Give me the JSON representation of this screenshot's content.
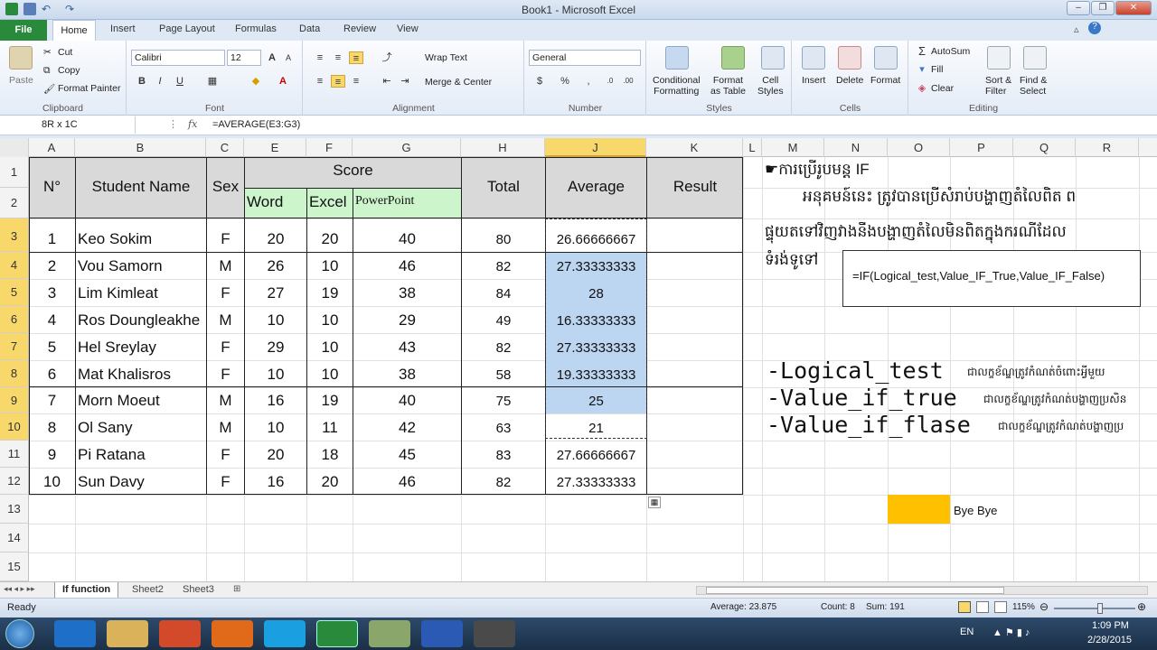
{
  "window": {
    "title": "Book1 - Microsoft Excel"
  },
  "ribbon_tabs": [
    "File",
    "Home",
    "Insert",
    "Page Layout",
    "Formulas",
    "Data",
    "Review",
    "View"
  ],
  "ribbon": {
    "clipboard": {
      "paste": "Paste",
      "cut": "Cut",
      "copy": "Copy",
      "format_painter": "Format Painter",
      "label": "Clipboard"
    },
    "font": {
      "name": "Calibri",
      "size": "12",
      "label": "Font"
    },
    "alignment": {
      "wrap": "Wrap Text",
      "merge": "Merge & Center",
      "label": "Alignment"
    },
    "number": {
      "format": "General",
      "label": "Number"
    },
    "styles": {
      "conditional": "Conditional\nFormatting",
      "format_table": "Format\nas Table",
      "cell_styles": "Cell\nStyles",
      "label": "Styles"
    },
    "cells": {
      "insert": "Insert",
      "delete": "Delete",
      "format": "Format",
      "label": "Cells"
    },
    "editing": {
      "autosum": "AutoSum",
      "fill": "Fill",
      "clear": "Clear",
      "sort": "Sort &\nFilter",
      "find": "Find &\nSelect",
      "label": "Editing"
    }
  },
  "formula_bar": {
    "name_box": "8R x 1C",
    "fx": "fx",
    "formula": "=AVERAGE(E3:G3)"
  },
  "columns": [
    "A",
    "B",
    "C",
    "E",
    "F",
    "G",
    "H",
    "J",
    "K",
    "L",
    "M",
    "N",
    "O",
    "P",
    "Q",
    "R"
  ],
  "rows": [
    "1",
    "2",
    "3",
    "4",
    "5",
    "6",
    "7",
    "8",
    "9",
    "10",
    "11",
    "12",
    "13",
    "14",
    "15"
  ],
  "table": {
    "headers": {
      "no": "N°",
      "name": "Student Name",
      "sex": "Sex",
      "score": "Score",
      "word": "Word",
      "excel": "Excel",
      "powerpoint": "PowerPoint",
      "total": "Total",
      "average": "Average",
      "result": "Result"
    },
    "rows": [
      {
        "no": "1",
        "name": "Keo Sokim",
        "sex": "F",
        "word": "20",
        "excel": "20",
        "pp": "40",
        "total": "80",
        "avg": "26.66666667"
      },
      {
        "no": "2",
        "name": "Vou Samorn",
        "sex": "M",
        "word": "26",
        "excel": "10",
        "pp": "46",
        "total": "82",
        "avg": "27.33333333"
      },
      {
        "no": "3",
        "name": "Lim Kimleat",
        "sex": "F",
        "word": "27",
        "excel": "19",
        "pp": "38",
        "total": "84",
        "avg": "28"
      },
      {
        "no": "4",
        "name": "Ros Doungleakhe",
        "sex": "M",
        "word": "10",
        "excel": "10",
        "pp": "29",
        "total": "49",
        "avg": "16.33333333"
      },
      {
        "no": "5",
        "name": "Hel Sreylay",
        "sex": "F",
        "word": "29",
        "excel": "10",
        "pp": "43",
        "total": "82",
        "avg": "27.33333333"
      },
      {
        "no": "6",
        "name": "Mat Khalisros",
        "sex": "F",
        "word": "10",
        "excel": "10",
        "pp": "38",
        "total": "58",
        "avg": "19.33333333"
      },
      {
        "no": "7",
        "name": "Morn Moeut",
        "sex": "M",
        "word": "16",
        "excel": "19",
        "pp": "40",
        "total": "75",
        "avg": "25"
      },
      {
        "no": "8",
        "name": "Ol Sany",
        "sex": "M",
        "word": "10",
        "excel": "11",
        "pp": "42",
        "total": "63",
        "avg": "21"
      },
      {
        "no": "9",
        "name": "Pi Ratana",
        "sex": "F",
        "word": "20",
        "excel": "18",
        "pp": "45",
        "total": "83",
        "avg": "27.66666667"
      },
      {
        "no": "10",
        "name": "Sun Davy",
        "sex": "F",
        "word": "16",
        "excel": "20",
        "pp": "46",
        "total": "82",
        "avg": "27.33333333"
      }
    ]
  },
  "notes": {
    "heading": "ការប្រើរូបមន្ត IF",
    "para1": "អនុគមន៍នេះ ត្រូវបានប្រើសំរាប់បង្ហាញតំលៃពិត ព",
    "para2": "ផ្ទុយតទៅវិញវាងនឹងបង្ហាញតំលៃមិនពិតក្នុងករណីដែល",
    "para3": "ទំរង់ទូទៅ",
    "syntax": "=IF(Logical_test,Value_IF_True,Value_IF_False)",
    "arg1": "-Logical_test",
    "arg1_desc": "ជាលក្ខខ័ណ្ឌត្រូវកំណត់ចំពោះអ្វីមួយ",
    "arg2": "-Value_if_true",
    "arg2_desc": "ជាលក្ខខ័ណ្ឌត្រូវកំណត់បង្ហាញប្រសិន",
    "arg3": "-Value_if_flase",
    "arg3_desc": "ជាលក្ខខ័ណ្ឌត្រូវកំណត់បង្ហាញប្រ",
    "bye": "Bye Bye"
  },
  "sheets": [
    "If function",
    "Sheet2",
    "Sheet3"
  ],
  "status": {
    "ready": "Ready",
    "average": "Average: 23.875",
    "count": "Count: 8",
    "sum": "Sum: 191",
    "zoom": "115%"
  },
  "taskbar": {
    "lang": "EN",
    "time": "1:09 PM",
    "date": "2/28/2015"
  },
  "colors": {
    "header_green": "#ccf5cc",
    "table_gray": "#d9d9d9",
    "selection_blue": "#bcd6f2",
    "bye_orange": "#ffc000",
    "excel_green": "#2a8a3c"
  }
}
